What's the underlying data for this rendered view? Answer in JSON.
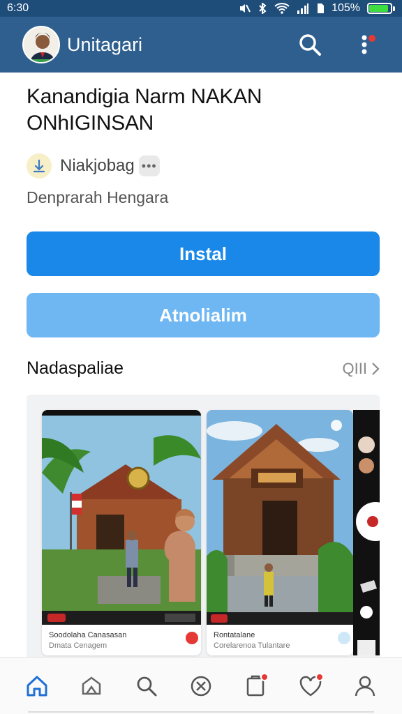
{
  "status_bar": {
    "time": "6:30",
    "battery": "105%"
  },
  "app_bar": {
    "title": "Unitagari",
    "icons": [
      "avatar",
      "search-icon",
      "more-vert-icon"
    ]
  },
  "app": {
    "name_line1": "Kanandigia Narm NAKAN",
    "name_line2": "ONhIGINSAN",
    "developer": "Niakjobag",
    "category": "Denprarah Hengara"
  },
  "buttons": {
    "install": "Instal",
    "secondary": "Atnolialim"
  },
  "section": {
    "title": "Nadaspaliae",
    "more_label": "QIII"
  },
  "screenshots": [
    {
      "caption": "Soodolaha Canasasan",
      "sub": "Dmata Cenagem"
    },
    {
      "caption": "Rontatalane",
      "sub": "Corelarenoa Tulantare"
    }
  ],
  "bottom_nav": [
    "home-icon",
    "explore-icon",
    "search-icon",
    "games-icon",
    "updates-icon",
    "favorites-icon",
    "profile-icon"
  ],
  "colors": {
    "app_bar": "#2e5f8e",
    "install": "#1a88e8",
    "secondary": "#6fb7f3"
  }
}
